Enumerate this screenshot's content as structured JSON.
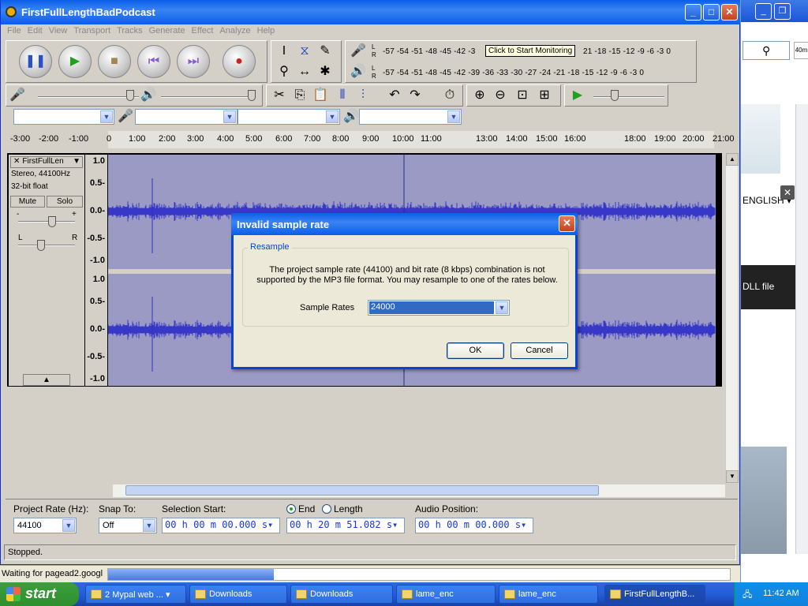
{
  "app": {
    "title": "FirstFullLengthBadPodcast",
    "menu": [
      "File",
      "Edit",
      "View",
      "Transport",
      "Tracks",
      "Generate",
      "Effect",
      "Analyze",
      "Help"
    ]
  },
  "meters": {
    "scale": "-57  -54  -51  -48  -45  -42  -39  -36  -33  -30  -27  -24  -21  -18  -15  -12   -9   -6   -3   0",
    "scale_top_right": "21  -18  -15  -12   -9   -6   -3   0",
    "scale_top_left": "-57  -54  -51  -48  -45  -42  -3",
    "monitor_hint": "Click to Start Monitoring",
    "l": "L",
    "r": "R"
  },
  "timeline": {
    "ticks": [
      "-3:00",
      "-2:00",
      "-1:00",
      "0",
      "1:00",
      "2:00",
      "3:00",
      "4:00",
      "5:00",
      "6:00",
      "7:00",
      "8:00",
      "9:00",
      "10:00",
      "11:00",
      "13:00",
      "14:00",
      "15:00",
      "16:00",
      "18:00",
      "19:00",
      "20:00",
      "21:00"
    ]
  },
  "track": {
    "name": "FirstFullLen",
    "format": "Stereo, 44100Hz",
    "bits": "32-bit float",
    "mute": "Mute",
    "solo": "Solo",
    "minus": "-",
    "plus": "+",
    "l": "L",
    "r": "R",
    "ruler": [
      "1.0",
      "0.5-",
      "0.0-",
      "-0.5-",
      "-1.0",
      "1.0",
      "0.5-",
      "0.0-",
      "-0.5-",
      "-1.0"
    ]
  },
  "selection": {
    "project_rate_label": "Project Rate (Hz):",
    "project_rate": "44100",
    "snap_label": "Snap To:",
    "snap": "Off",
    "sel_start_label": "Selection Start:",
    "sel_start": "00 h 00 m 00.000 s",
    "end_label": "End",
    "length_label": "Length",
    "end_value": "00 h 20 m 51.082 s",
    "audio_pos_label": "Audio Position:",
    "audio_pos": "00 h 00 m 00.000 s"
  },
  "status": "Stopped.",
  "dialog": {
    "title": "Invalid sample rate",
    "group": "Resample",
    "message": "The project sample rate (44100) and bit rate (8 kbps) combination is not supported by the MP3 file format.  You may resample to one of the rates below.",
    "rates_label": "Sample Rates",
    "rate_value": "24000",
    "ok": "OK",
    "cancel": "Cancel"
  },
  "browser": {
    "english": "ENGLISH",
    "dll": "DLL file",
    "ad40m": "40m",
    "status": "Waiting for pagead2.googl"
  },
  "taskbar": {
    "start": "start",
    "tasks": [
      "2 Mypal web ...",
      "Downloads",
      "Downloads",
      "lame_enc",
      "lame_enc",
      "FirstFullLengthB..."
    ],
    "clock": "11:42 AM"
  }
}
